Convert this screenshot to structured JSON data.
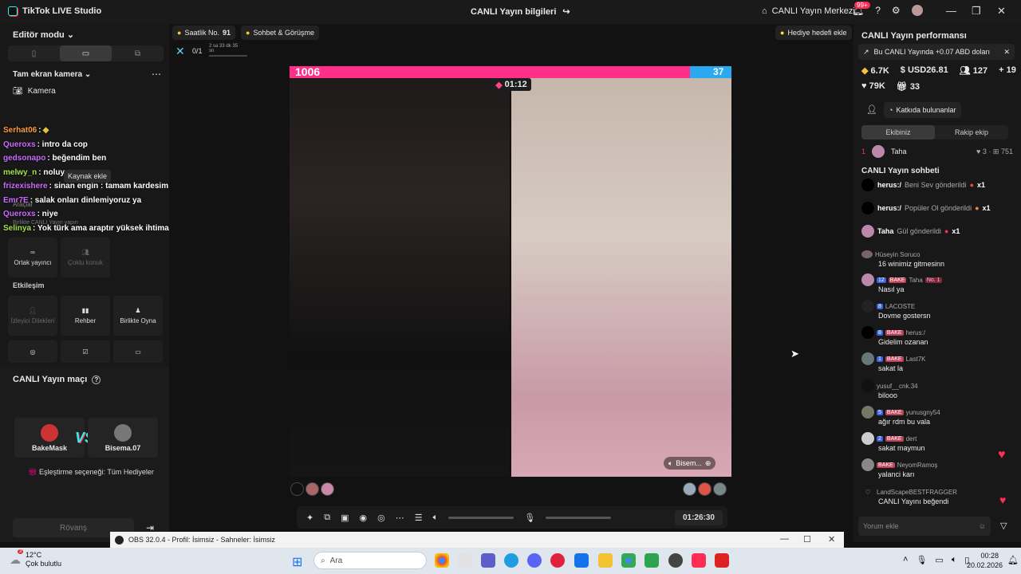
{
  "app": {
    "title": "TikTok LIVE Studio",
    "center_title": "CANLI Yayın bilgileri",
    "live_center": "CANLI Yayın Merkezi",
    "notif_badge": "99+"
  },
  "left": {
    "editor_mode": "Editör modu",
    "camera_section": "Tam ekran kamera",
    "camera_item": "Kamera",
    "tooltip": "Kaynak ekle",
    "tools_label": "Araçlar",
    "tools_sub": "Birlikte CANLI Yayın yapın",
    "chat_overlay": [
      {
        "user": "Serhat06",
        "text": ":"
      },
      {
        "user": "Queroxs",
        "text": ": intro da cop"
      },
      {
        "user": "gedsonapo",
        "text": ": beğendim ben"
      },
      {
        "user": "melwy_n",
        "text": ": noluyo"
      },
      {
        "user": "frizexishere",
        "text": ": sinan engin : tamam kardesim"
      },
      {
        "user": "Emr7E",
        "text": ": salak onları dinlemiyoruz ya"
      },
      {
        "user": "Queroxs",
        "text": ": niye"
      },
      {
        "user": "Selinya",
        "text": ": Yok türk ama araptır yüksek ihtimalle"
      }
    ],
    "tiles_row1": [
      "Ortak yayıncı",
      "Çoklu konuk"
    ],
    "interaction_label": "Etkileşim",
    "tiles_row2": [
      "İzleyici Dilekleri",
      "Rehber",
      "Birlikte Oyna"
    ],
    "match_title": "CANLI Yayın maçı",
    "player1": "BakeMask",
    "player2": "Bisema.07",
    "vs": "VS",
    "match_option": "Eşleştirme seçeneği: Tüm Hediyeler",
    "rematch": "Rövanş"
  },
  "center": {
    "hourly_rank": "Saatlik No.",
    "hourly_value": "91",
    "chat_chip": "Sohbet & Görüşme",
    "gift_goal": "Hediye hedefi ekle",
    "mini_count": "0/1",
    "mini_time": "2 sa 33 dk 35 sn",
    "score_left": "1006",
    "score_right": "37",
    "battle_timer": "01:12",
    "opponent_label": "Bisem...",
    "live_duration": "01:26:30"
  },
  "right": {
    "perf_title": "CANLI Yayın performansı",
    "notice": "Bu CANLI Yayında +0.07 ABD doları",
    "stats1": [
      "6.7K",
      "USD26.81",
      "127",
      "19"
    ],
    "stats2": [
      "79K",
      "33"
    ],
    "contributors": "Katkıda bulunanlar",
    "team_tabs": [
      "Ekibiniz",
      "Rakip ekip"
    ],
    "rank": {
      "pos": "1",
      "name": "Taha",
      "a": "3",
      "b": "751"
    },
    "chat_title": "CANLI Yayın sohbeti",
    "gifts": [
      {
        "user": "herus:/",
        "text": "Beni Sev gönderildi",
        "count": "x1"
      },
      {
        "user": "herus:/",
        "text": "Popüler Ol gönderildi",
        "count": "x1"
      },
      {
        "user": "Taha",
        "text": "Gül gönderildi",
        "count": "x1"
      }
    ],
    "messages": [
      {
        "user": "Hüseyin Soruco",
        "text": "16 winimiz gitmesinn"
      },
      {
        "user": "Taha",
        "lvl": "12",
        "bake": "BAKE",
        "no1": "No. 1",
        "text": "Nasıl ya"
      },
      {
        "user": "LACOSTE",
        "lvl": "8",
        "text": "Dovme gostersn"
      },
      {
        "user": "herus:/",
        "lvl": "8",
        "bake": "BAKE",
        "text": "Gidelim ozanan"
      },
      {
        "user": "Last7K",
        "lvl": "1",
        "bake": "BAKE",
        "text": "sakat la"
      },
      {
        "user": "yusuf__cnk.34",
        "text": "bilooo"
      },
      {
        "user": "yunusgny54",
        "lvl": "5",
        "bake": "BAKE",
        "text": "ağır rdm bu vala"
      },
      {
        "user": "dert",
        "lvl": "2",
        "bake": "BAKE",
        "text": "sakat maymun"
      },
      {
        "user": "NeyomRamoş",
        "bake": "BAKE",
        "text": "yalanci karı"
      },
      {
        "user": "LandScapeBESTFRAGGER",
        "text": "CANLI Yayını beğendi"
      }
    ],
    "comment_placeholder": "Yorum ekle"
  },
  "obs": {
    "title": "OBS 32.0.4 - Profil: İsimsiz - Sahneler: İsimsiz"
  },
  "taskbar": {
    "temp": "12°C",
    "weather": "Çok bulutlu",
    "search": "Ara",
    "time": "00:28",
    "date": "20.02.2026",
    "weather_badge": "3"
  }
}
